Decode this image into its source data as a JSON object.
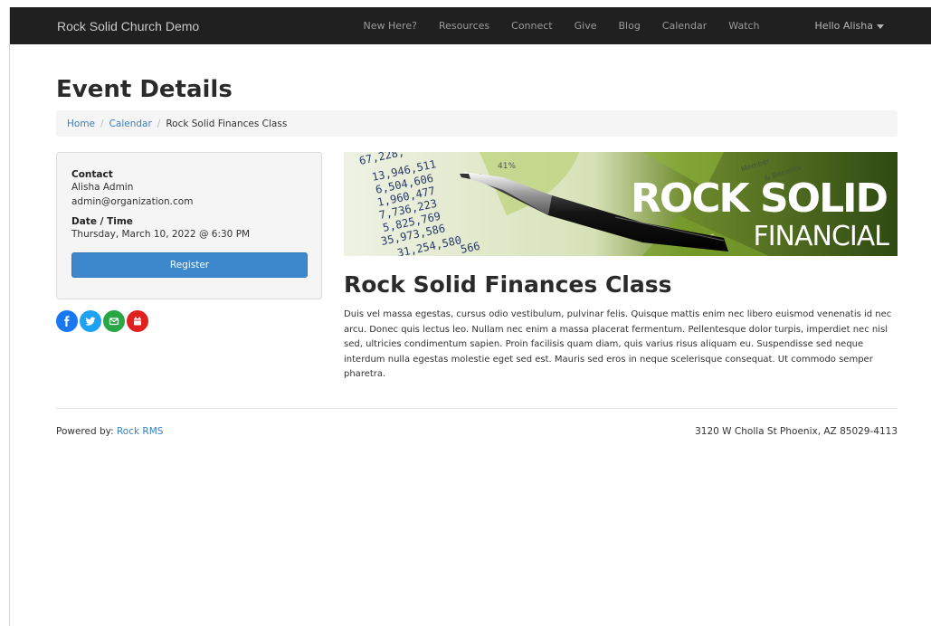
{
  "navbar": {
    "brand": "Rock Solid Church Demo",
    "items": [
      "New Here?",
      "Resources",
      "Connect",
      "Give",
      "Blog",
      "Calendar",
      "Watch"
    ],
    "user": "Hello Alisha"
  },
  "page": {
    "title": "Event Details",
    "breadcrumb": [
      "Home",
      "Calendar",
      "Rock Solid Finances Class"
    ]
  },
  "sidebar": {
    "contact_label": "Contact",
    "contact_name": "Alisha Admin",
    "contact_email": "admin@organization.com",
    "datetime_label": "Date / Time",
    "datetime_value": "Thursday, March 10, 2022 @ 6:30 PM",
    "register_label": "Register",
    "social_icons": [
      "facebook-icon",
      "twitter-icon",
      "email-icon",
      "calendar-icon"
    ],
    "social_colors": [
      "#1877f2",
      "#1da1f2",
      "#28a745",
      "#e0221e"
    ]
  },
  "banner": {
    "headline": "ROCK SOLID",
    "subline": "FINANCIAL",
    "numbers": [
      "67,228,",
      "13,946,511",
      "6,504,606",
      "1,960,477",
      "7,736,223",
      "5,825,769",
      "35,973,586",
      "31,254,580",
      "566"
    ],
    "misc": [
      "41%",
      "Loans",
      "Member",
      "& Benefits"
    ]
  },
  "event": {
    "title": "Rock Solid Finances Class",
    "description": "Duis vel massa egestas, cursus odio vestibulum, pulvinar felis. Quisque mattis enim nec libero euismod venenatis id nec arcu. Donec quis lectus leo. Nullam nec enim a massa placerat fermentum. Pellentesque dolor turpis, imperdiet nec nisl sed, ultricies condimentum sapien. Proin facilisis quam diam, quis varius risus aliquam eu. Suspendisse sed neque interdum nulla egestas molestie eget sed est. Mauris sed eros in neque scelerisque consequat. Ut commodo semper pharetra."
  },
  "footer": {
    "powered_prefix": "Powered by: ",
    "powered_link": "Rock RMS",
    "address": "3120 W Cholla St Phoenix, AZ 85029-4113"
  }
}
